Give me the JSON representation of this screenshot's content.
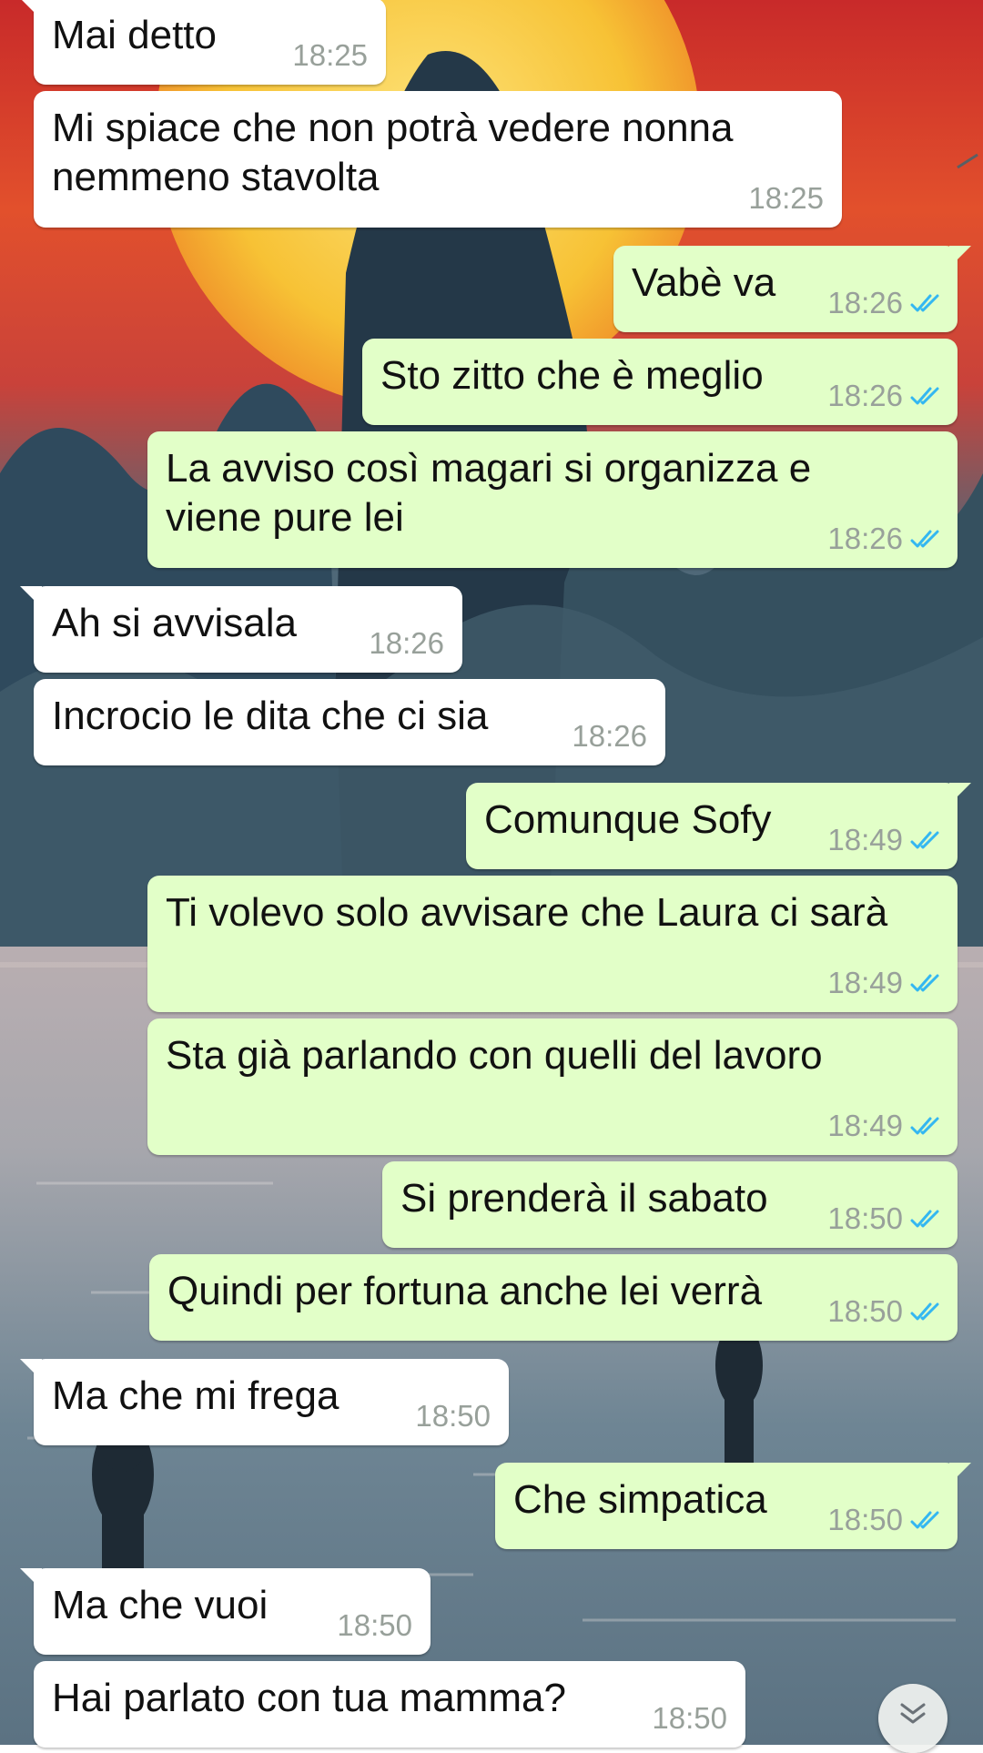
{
  "wallpaper": {
    "sky_top": "#d6342a",
    "sun": "#f7d23a",
    "mountain": "#2f4456",
    "water": "#8da0ad"
  },
  "colors": {
    "incoming_bubble": "#ffffff",
    "outgoing_bubble": "#e2ffc8",
    "timestamp": "#98a09a",
    "read_ticks": "#34b7f1"
  },
  "messages": [
    {
      "dir": "in",
      "lines": [
        "Mai detto"
      ],
      "time": "18:25"
    },
    {
      "dir": "in",
      "lines": [
        "Mi spiace che non potrà vedere nonna",
        "nemmeno stavolta"
      ],
      "time": "18:25"
    },
    {
      "dir": "out",
      "lines": [
        "Vabè va"
      ],
      "time": "18:26",
      "status": "read"
    },
    {
      "dir": "out",
      "lines": [
        "Sto zitto che è meglio"
      ],
      "time": "18:26",
      "status": "read"
    },
    {
      "dir": "out",
      "lines": [
        "La avviso così magari si organizza e",
        "viene pure lei"
      ],
      "time": "18:26",
      "status": "read"
    },
    {
      "dir": "in",
      "lines": [
        "Ah si avvisala"
      ],
      "time": "18:26"
    },
    {
      "dir": "in",
      "lines": [
        "Incrocio le dita che ci sia"
      ],
      "time": "18:26"
    },
    {
      "dir": "out",
      "lines": [
        "Comunque Sofy"
      ],
      "time": "18:49",
      "status": "read"
    },
    {
      "dir": "out",
      "lines": [
        "Ti volevo solo avvisare che Laura ci sarà"
      ],
      "time": "18:49",
      "status": "read"
    },
    {
      "dir": "out",
      "lines": [
        "Sta già parlando con quelli del lavoro"
      ],
      "time": "18:49",
      "status": "read"
    },
    {
      "dir": "out",
      "lines": [
        "Si prenderà il sabato"
      ],
      "time": "18:50",
      "status": "read"
    },
    {
      "dir": "out",
      "lines": [
        "Quindi per fortuna anche lei verrà"
      ],
      "time": "18:50",
      "status": "read"
    },
    {
      "dir": "in",
      "lines": [
        "Ma che mi frega"
      ],
      "time": "18:50"
    },
    {
      "dir": "out",
      "lines": [
        "Che simpatica"
      ],
      "time": "18:50",
      "status": "read"
    },
    {
      "dir": "in",
      "lines": [
        "Ma che vuoi"
      ],
      "time": "18:50"
    },
    {
      "dir": "in",
      "lines": [
        "Hai parlato con tua mamma?"
      ],
      "time": "18:50"
    }
  ],
  "scroll_button": {
    "icon": "double-chevron-down-icon"
  },
  "edge_arrow": {
    "icon": "chevron-right-icon"
  }
}
